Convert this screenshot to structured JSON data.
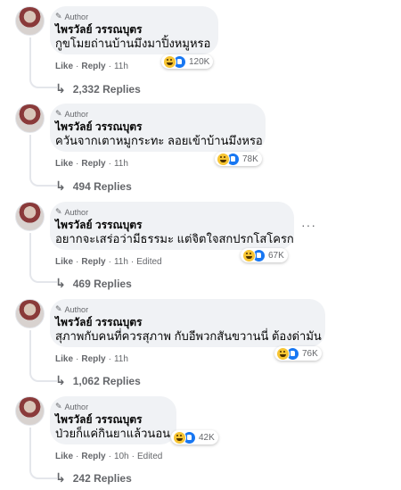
{
  "comments": [
    {
      "author_badge": "Author",
      "name": "ไพรวัลย์ วรรณบุตร",
      "text": "กูขโมยถ่านบ้านมึงมาปิ้งหมูหรอ",
      "reaction_count": "120K",
      "like_label": "Like",
      "reply_label": "Reply",
      "time": "11h",
      "edited": "",
      "replies_label": "2,332 Replies"
    },
    {
      "author_badge": "Author",
      "name": "ไพรวัลย์ วรรณบุตร",
      "text": "ควันจากเตาหมูกระทะ ลอยเข้าบ้านมึงหรอ",
      "reaction_count": "78K",
      "like_label": "Like",
      "reply_label": "Reply",
      "time": "11h",
      "edited": "",
      "replies_label": "494 Replies"
    },
    {
      "author_badge": "Author",
      "name": "ไพรวัลย์ วรรณบุตร",
      "text": "อยากจะเสร่อว่ามีธรรมะ แต่จิตใจสกปรกโสโครก",
      "reaction_count": "67K",
      "like_label": "Like",
      "reply_label": "Reply",
      "time": "11h",
      "edited": "Edited",
      "replies_label": "469 Replies",
      "more": "···"
    },
    {
      "author_badge": "Author",
      "name": "ไพรวัลย์ วรรณบุตร",
      "text": "สุภาพกับคนที่ควรสุภาพ กับอีพวกสันขวานนี่ ต้องด่ามัน",
      "reaction_count": "76K",
      "like_label": "Like",
      "reply_label": "Reply",
      "time": "11h",
      "edited": "",
      "replies_label": "1,062 Replies"
    },
    {
      "author_badge": "Author",
      "name": "ไพรวัลย์ วรรณบุตร",
      "text": "ป่วยก็แค่กินยาแล้วนอน",
      "reaction_count": "42K",
      "like_label": "Like",
      "reply_label": "Reply",
      "time": "10h",
      "edited": "Edited",
      "replies_label": "242 Replies"
    }
  ],
  "icons": {
    "author": "pencil-icon",
    "reply_arrow": "reply-arrow-icon",
    "reactions": [
      "haha-reaction-icon",
      "like-reaction-icon"
    ]
  },
  "colors": {
    "bubble": "#f0f2f5",
    "meta_text": "#65676b",
    "like_blue": "#1877f2",
    "haha_yellow": "#f7c533"
  }
}
